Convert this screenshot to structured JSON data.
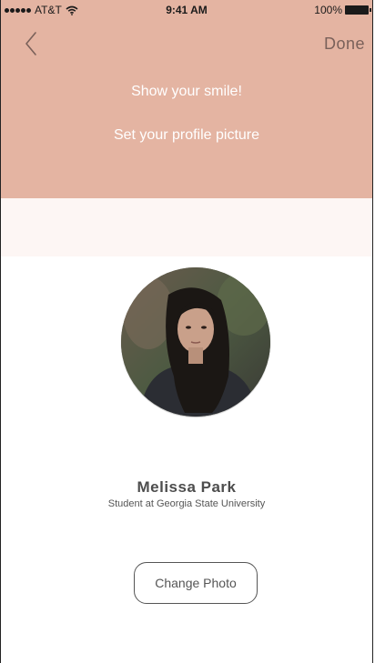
{
  "status_bar": {
    "carrier": "AT&T",
    "time": "9:41 AM",
    "battery": "100%"
  },
  "nav": {
    "back_icon": "chevron-left-icon",
    "done_label": "Done"
  },
  "header": {
    "title": "Show your smile!",
    "subtitle": "Set your profile picture"
  },
  "profile": {
    "name": "Melissa Park",
    "description": "Student at Georgia State University"
  },
  "actions": {
    "change_photo_label": "Change Photo"
  },
  "colors": {
    "header_bg": "#e4b4a2",
    "band_bg": "#fdf6f4",
    "text_primary": "#4d4d4d"
  }
}
